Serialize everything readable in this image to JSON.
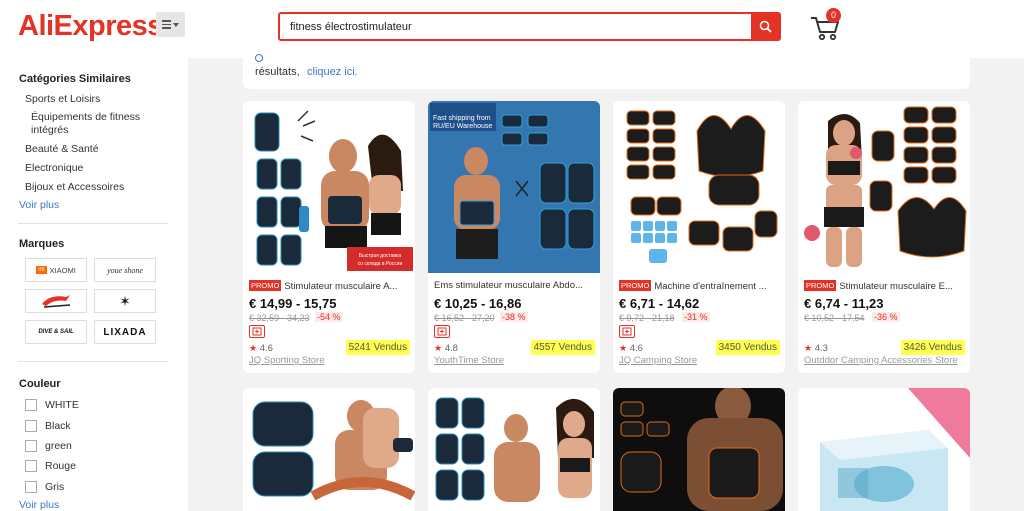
{
  "header": {
    "logo": "AliExpress",
    "logo_mark": "™",
    "search_value": "fitness électrostimulateur",
    "cart_count": "0"
  },
  "sidebar": {
    "categories_title": "Catégories Similaires",
    "categories": [
      {
        "label": "Sports et Loisirs",
        "level": 1
      },
      {
        "label": "Équipements de fitness intégrés",
        "level": 2
      },
      {
        "label": "Beauté & Santé",
        "level": 1
      },
      {
        "label": "Electronique",
        "level": 1
      },
      {
        "label": "Bijoux et Accessoires",
        "level": 1
      }
    ],
    "voir_plus_1": "Voir plus",
    "brands_title": "Marques",
    "brands": [
      "XIAOMI",
      "youe shone",
      "SUGAS",
      "",
      "DIVE & SAIL",
      "LIXADA"
    ],
    "colors_title": "Couleur",
    "colors": [
      "WHITE",
      "Black",
      "green",
      "Rouge",
      "Gris"
    ],
    "voir_plus_2": "Voir plus"
  },
  "notice": {
    "text": "résultats,",
    "link": "cliquez ici."
  },
  "products": [
    {
      "promo": "PROMO",
      "title": "Stimulateur musculaire A...",
      "price": "€ 14,99 - 15,75",
      "old_price": "€ 32,59 - 34,23",
      "discount": "-54 %",
      "has_badge": true,
      "rating": "4.6",
      "sold": "5241 Vendus",
      "store": "JQ Sporting Store",
      "overlay": "Быстрая доставка со склада в России"
    },
    {
      "promo": "",
      "title": "Ems stimulateur musculaire Abdo...",
      "price": "€ 10,25 - 16,86",
      "old_price": "€ 16,52 - 27,20",
      "discount": "-38 %",
      "has_badge": true,
      "rating": "4.8",
      "sold": "4557 Vendus",
      "store": "YouthTime Store",
      "overlay_line1": "Fast shipping from",
      "overlay_line2": "RU/EU Warehouse"
    },
    {
      "promo": "PROMO",
      "title": "Machine d'entraînement ...",
      "price": "€ 6,71 - 14,62",
      "old_price": "€ 9,72 - 21,18",
      "discount": "-31 %",
      "has_badge": true,
      "rating": "4.6",
      "sold": "3450 Vendus",
      "store": "JQ Camping Store"
    },
    {
      "promo": "PROMO",
      "title": "Stimulateur musculaire E...",
      "price": "€ 6,74 - 11,23",
      "old_price": "€ 10,52 - 17,54",
      "discount": "-36 %",
      "has_badge": false,
      "rating": "4.3",
      "sold": "3426 Vendus",
      "store": "Outddor Camping Accessories Store"
    }
  ],
  "colors": {
    "brand": "#e43225",
    "link": "#3c78c8",
    "highlight": "#ffff4d"
  }
}
